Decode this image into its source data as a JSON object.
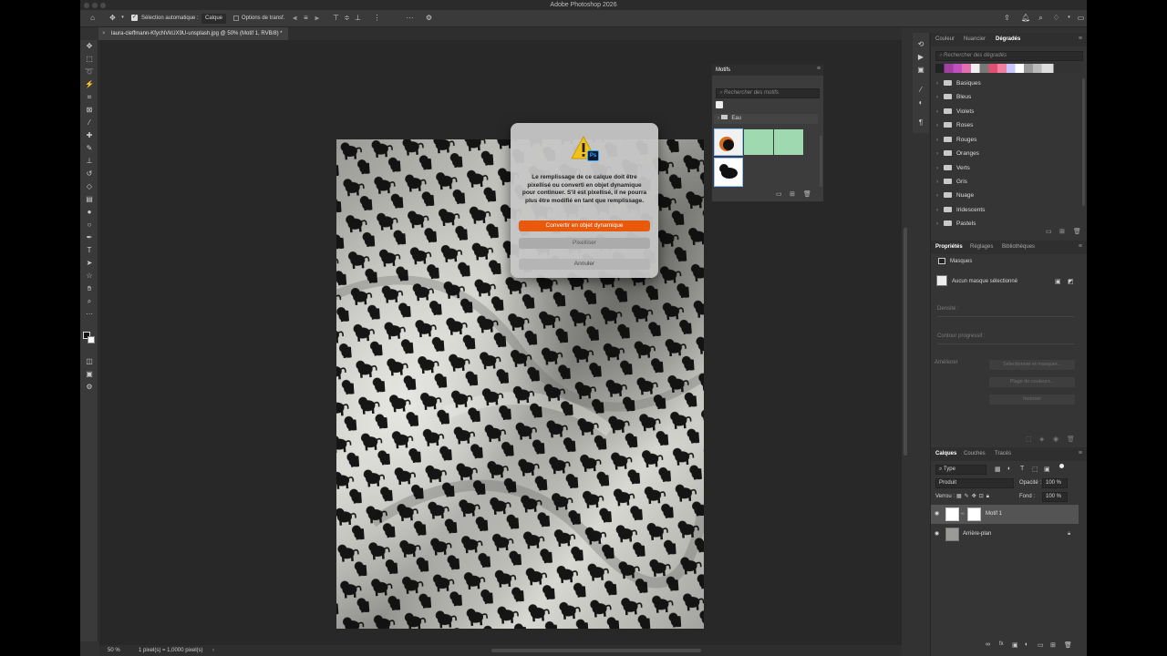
{
  "window": {
    "title": "Adobe Photoshop 2026"
  },
  "options_bar": {
    "auto_select_label": "Sélection automatique :",
    "auto_select_value": "Calque",
    "transform_options_label": "Options de transf."
  },
  "document": {
    "tab_title": "laura-cleffmann-KfycNVkUX9U-unsplash.jpg @ 50% (Motif 1, RVB/8) *"
  },
  "status_bar": {
    "zoom": "50 %",
    "info": "1 pixel(s) = 1,0000 pixel(s)",
    "arrow": "›"
  },
  "dialog": {
    "message": "Le remplissage de ce calque doit être pixellisé ou converti en objet dynamique pour continuer. S'il est pixellisé, il ne pourra plus être modifié en tant que remplissage.",
    "app_badge": "Ps",
    "convert_label": "Convertir en objet dynamique",
    "rasterize_label": "Pixelliser",
    "cancel_label": "Annuler"
  },
  "motifs_panel": {
    "title": "Motifs",
    "search_placeholder": "Rechercher des motifs",
    "group_name": "Eau"
  },
  "gradients_panel": {
    "tabs": [
      "Couleur",
      "Nuancier",
      "Dégradés"
    ],
    "active_tab": "Dégradés",
    "search_placeholder": "Rechercher des dégradés",
    "folders": [
      "Basiques",
      "Bleus",
      "Violets",
      "Roses",
      "Rouges",
      "Oranges",
      "Verts",
      "Gris",
      "Nuage",
      "Iridescents",
      "Pastels"
    ]
  },
  "properties_panel": {
    "tabs": [
      "Propriétés",
      "Réglages",
      "Bibliothèques"
    ],
    "active_tab": "Propriétés",
    "section_title": "Masques",
    "mask_status": "Aucun masque sélectionné",
    "density_label": "Densité :",
    "feather_label": "Contour progressif :",
    "refine_label": "Améliorer",
    "select_mask_button": "Sélectionner et masquer...",
    "color_range_button": "Plage de couleurs...",
    "invert_button": "Inverser"
  },
  "layers_panel": {
    "tabs": [
      "Calques",
      "Couches",
      "Tracés"
    ],
    "active_tab": "Calques",
    "filter_label": "Type",
    "blend_mode": "Produit",
    "opacity_label": "Opacité :",
    "opacity_value": "100 %",
    "lock_label": "Verrou :",
    "fill_label": "Fond :",
    "fill_value": "100 %",
    "layers": [
      {
        "name": "Motif 1",
        "visible": true,
        "selected": true
      },
      {
        "name": "Arrière-plan",
        "visible": true,
        "selected": false,
        "locked": true
      }
    ]
  },
  "colors": {
    "accent_orange": "#e8590c",
    "panel_bg": "#353535",
    "canvas_bg": "#282828"
  }
}
